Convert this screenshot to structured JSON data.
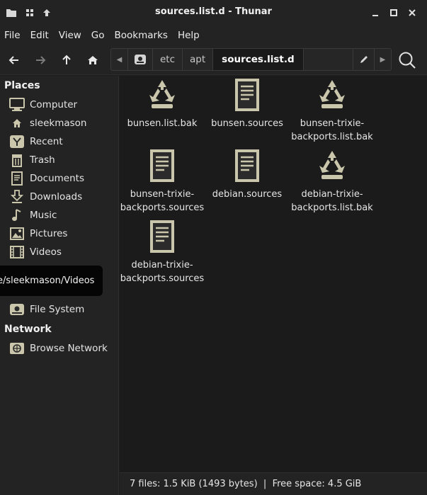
{
  "window": {
    "title": "sources.list.d - Thunar"
  },
  "menubar": {
    "items": [
      "File",
      "Edit",
      "View",
      "Go",
      "Bookmarks",
      "Help"
    ]
  },
  "pathbar": {
    "segments": [
      "etc",
      "apt",
      "sources.list.d"
    ],
    "active_index": 2
  },
  "sidebar": {
    "places_heading": "Places",
    "places": [
      {
        "label": "Computer",
        "icon": "computer-icon"
      },
      {
        "label": "sleekmason",
        "icon": "home-icon"
      },
      {
        "label": "Recent",
        "icon": "recent-icon"
      },
      {
        "label": "Trash",
        "icon": "trash-icon"
      },
      {
        "label": "Documents",
        "icon": "documents-icon"
      },
      {
        "label": "Downloads",
        "icon": "downloads-icon"
      },
      {
        "label": "Music",
        "icon": "music-icon"
      },
      {
        "label": "Pictures",
        "icon": "pictures-icon"
      },
      {
        "label": "Videos",
        "icon": "videos-icon"
      }
    ],
    "devices": [
      {
        "label": "File System",
        "icon": "drive-icon"
      }
    ],
    "network_heading": "Network",
    "network": [
      {
        "label": "Browse Network",
        "icon": "network-icon"
      }
    ],
    "tooltip": "e/sleekmason/Videos"
  },
  "files": [
    {
      "name": "bunsen.list.bak",
      "lines": [
        "bunsen.list.bak"
      ],
      "icon": "recycle-icon"
    },
    {
      "name": "bunsen.sources",
      "lines": [
        "bunsen.sources"
      ],
      "icon": "text-file-icon"
    },
    {
      "name": "bunsen-trixie-backports.list.bak",
      "lines": [
        "bunsen-trixie-",
        "backports.list.bak"
      ],
      "icon": "recycle-icon"
    },
    {
      "name": "bunsen-trixie-backports.sources",
      "lines": [
        "bunsen-trixie-",
        "backports.sources"
      ],
      "icon": "text-file-icon"
    },
    {
      "name": "debian.sources",
      "lines": [
        "debian.sources"
      ],
      "icon": "text-file-icon"
    },
    {
      "name": "debian-trixie-backports.list.bak",
      "lines": [
        "debian-trixie-",
        "backports.list.bak"
      ],
      "icon": "recycle-icon"
    },
    {
      "name": "debian-trixie-backports.sources",
      "lines": [
        "debian-trixie-",
        "backports.sources"
      ],
      "icon": "text-file-icon"
    }
  ],
  "statusbar": {
    "text": "7 files: 1.5 KiB (1493 bytes)  |  Free space: 4.5 GiB"
  },
  "colors": {
    "background": "#1b1b1b",
    "sidebar": "#232323",
    "icon_olive": "#c9c6ac"
  }
}
